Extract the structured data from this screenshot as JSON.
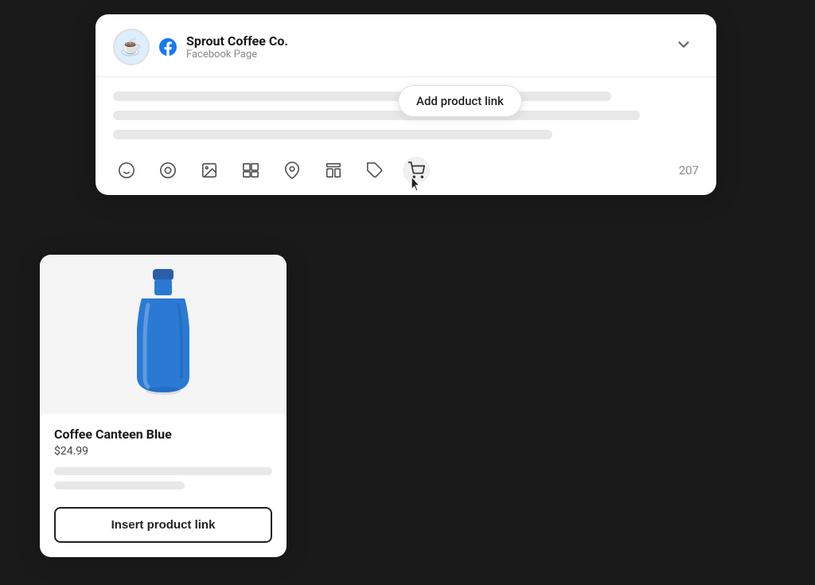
{
  "header": {
    "account_name": "Sprout Coffee Co.",
    "account_type": "Facebook Page",
    "chevron_label": "▾",
    "fb_icon": "f"
  },
  "composer": {
    "text_lines": [
      {
        "width": "85%"
      },
      {
        "width": "90%"
      },
      {
        "width": "75%"
      }
    ],
    "tooltip": "Add product link",
    "char_count": "207"
  },
  "toolbar": {
    "icons": [
      {
        "name": "emoji-icon",
        "symbol": "☺",
        "label": "Emoji"
      },
      {
        "name": "mention-icon",
        "symbol": "◎",
        "label": "Mention"
      },
      {
        "name": "photo-icon",
        "symbol": "📷",
        "label": "Photo"
      },
      {
        "name": "gallery-icon",
        "symbol": "⊟",
        "label": "Gallery"
      },
      {
        "name": "location-icon",
        "symbol": "📍",
        "label": "Location"
      },
      {
        "name": "layout-icon",
        "symbol": "⊞",
        "label": "Layout"
      },
      {
        "name": "tag-icon",
        "symbol": "🏷",
        "label": "Tag"
      },
      {
        "name": "cart-icon",
        "symbol": "🛒",
        "label": "Cart",
        "active": true
      }
    ]
  },
  "product_card": {
    "name": "Coffee Canteen Blue",
    "price": "$24.99",
    "insert_button_label": "Insert product link",
    "desc_lines": [
      {
        "width": "100%"
      },
      {
        "width": "55%"
      }
    ]
  }
}
